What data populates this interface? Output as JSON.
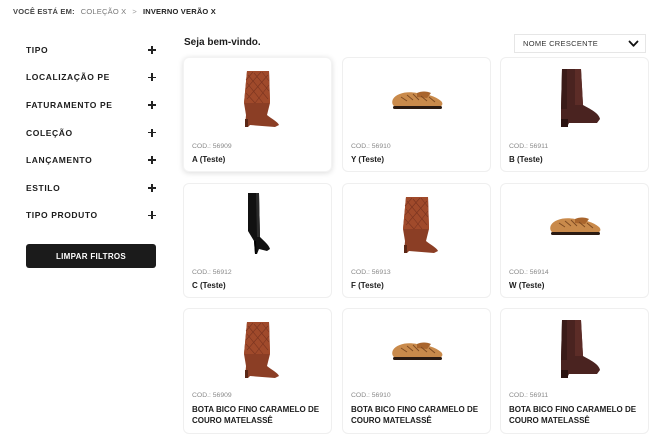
{
  "breadcrumb": {
    "lead": "VOCÊ ESTÁ EM:",
    "link": "COLEÇÃO X",
    "separator": ">",
    "current": "INVERNO VERÃO X"
  },
  "sidebar": {
    "filters": [
      {
        "label": "TIPO"
      },
      {
        "label": "LOCALIZAÇÃO PE"
      },
      {
        "label": "FATURAMENTO PE"
      },
      {
        "label": "COLEÇÃO"
      },
      {
        "label": "LANÇAMENTO"
      },
      {
        "label": "ESTILO"
      },
      {
        "label": "TIPO PRODUTO"
      }
    ],
    "clear_label": "LIMPAR FILTROS"
  },
  "main": {
    "welcome": "Seja bem-vindo.",
    "sort": {
      "selected": "NOME CRESCENTE"
    }
  },
  "products": [
    {
      "code": "COD.: 56909",
      "name": "A (Teste)",
      "image": "folded-boot-icon"
    },
    {
      "code": "COD.: 56910",
      "name": "Y (Teste)",
      "image": "loafer-icon"
    },
    {
      "code": "COD.: 56911",
      "name": "B (Teste)",
      "image": "chelsea-boot-icon"
    },
    {
      "code": "COD.: 56912",
      "name": "C (Teste)",
      "image": "tall-heel-boot-icon"
    },
    {
      "code": "COD.: 56913",
      "name": "F (Teste)",
      "image": "folded-boot-icon"
    },
    {
      "code": "COD.: 56914",
      "name": "W (Teste)",
      "image": "loafer-icon"
    },
    {
      "code": "COD.: 56909",
      "name": "BOTA BICO FINO CARAMELO DE COURO MATELASSÊ",
      "image": "folded-boot-icon"
    },
    {
      "code": "COD.: 56910",
      "name": "BOTA BICO FINO CARAMELO DE COURO MATELASSÊ",
      "image": "loafer-icon"
    },
    {
      "code": "COD.: 56911",
      "name": "BOTA BICO FINO CARAMELO DE COURO MATELASSÊ",
      "image": "chelsea-boot-icon"
    }
  ],
  "colors": {
    "accent_dark": "#1b1b1b",
    "boot_brown": "#8b3e25",
    "loafer_tan": "#c98a4b",
    "chelsea_dark": "#4a2320"
  }
}
